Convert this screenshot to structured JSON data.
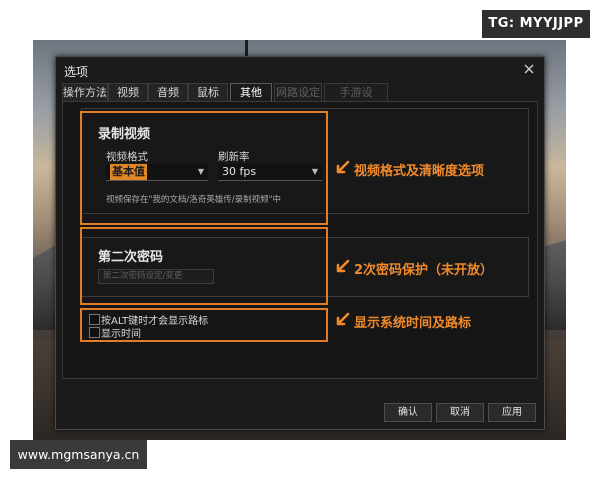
{
  "watermarks": {
    "top": "TG: MYYJJPP",
    "bottom": "www.mgmsanya.cn"
  },
  "dialog": {
    "title": "选项",
    "tabs": [
      {
        "label": "操作方法",
        "state": "normal"
      },
      {
        "label": "视频",
        "state": "normal"
      },
      {
        "label": "音频",
        "state": "normal"
      },
      {
        "label": "鼠标",
        "state": "normal"
      },
      {
        "label": "其他",
        "state": "active"
      },
      {
        "label": "网路设定",
        "state": "disabled"
      },
      {
        "label": "手游设定……",
        "state": "disabled"
      }
    ],
    "record_video": {
      "title": "录制视频",
      "format_label": "视频格式",
      "format_value": "基本值",
      "refresh_label": "刷新率",
      "refresh_value": "30 fps",
      "note": "视频保存在\"我的文档/洛奇英雄传/录制视频\"中"
    },
    "second_password": {
      "title": "第二次密码",
      "input_text": "第二次密码设定/变更"
    },
    "checkboxes": [
      {
        "label": "按ALT键时才会显示路标",
        "checked": false
      },
      {
        "label": "显示时间",
        "checked": false
      }
    ],
    "buttons": {
      "confirm": "确认",
      "cancel": "取消",
      "apply": "应用"
    }
  },
  "annotations": {
    "video": "视频格式及清晰度选项",
    "password": "2次密码保护（未开放）",
    "time": "显示系统时间及路标"
  },
  "colors": {
    "accent": "#e07d26",
    "dialog_bg": "#1b1b1b",
    "annotation": "#f08a2a"
  }
}
